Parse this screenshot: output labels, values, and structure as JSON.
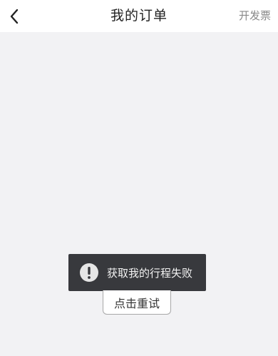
{
  "header": {
    "title": "我的订单",
    "back_icon": "chevron-left-icon",
    "invoice_label": "开发票"
  },
  "toast": {
    "icon": "alert-circle-icon",
    "message": "获取我的行程失败"
  },
  "retry": {
    "label": "点击重试"
  },
  "colors": {
    "background": "#f2f2f4",
    "toast_background": "#38393d"
  }
}
